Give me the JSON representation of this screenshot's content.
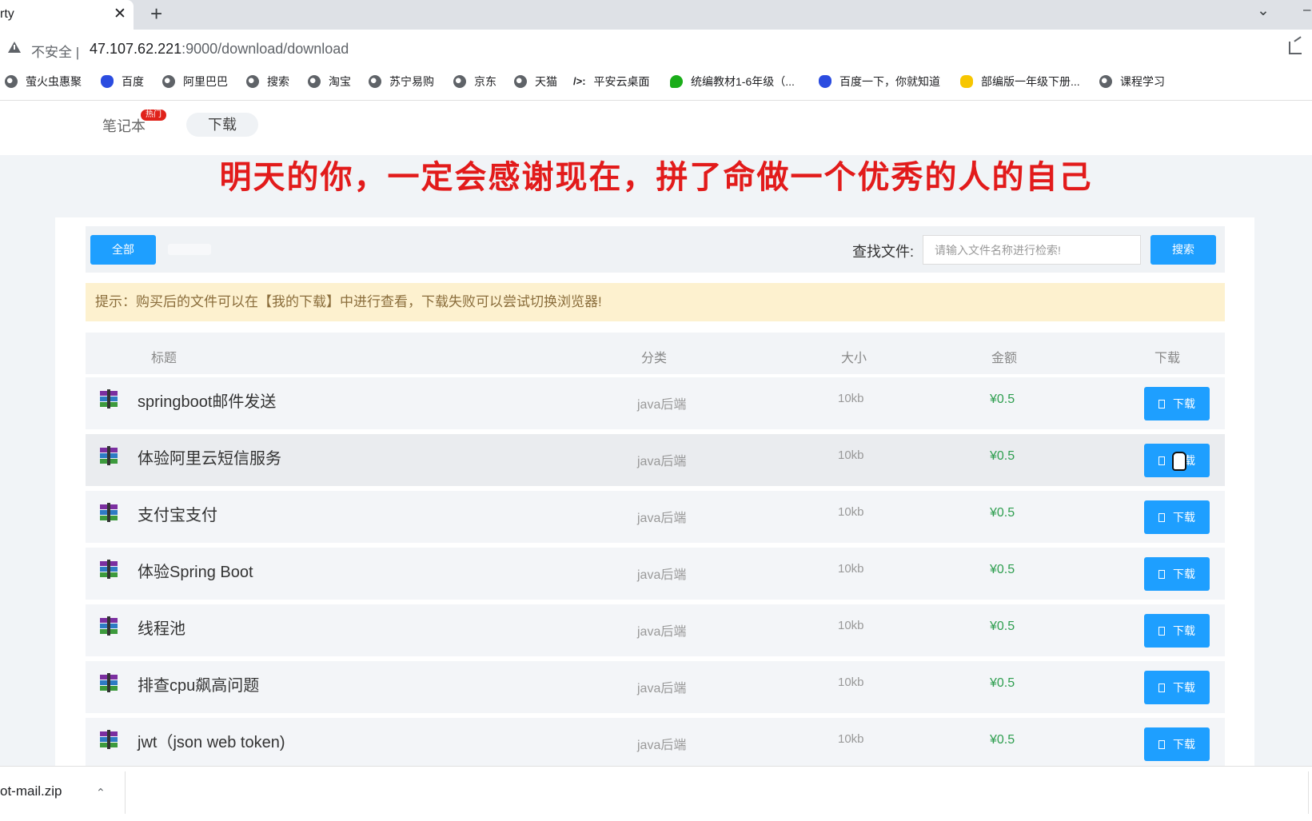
{
  "browser": {
    "tab_title": "rty",
    "tab_close": "✕",
    "new_tab": "+",
    "tab_list": "⌄",
    "minimize": "–",
    "insecure_label": "不安全 |",
    "url_host": "47.107.62.221",
    "url_rest": ":9000/download/download",
    "bookmarks": [
      {
        "label": "萤火虫惠聚",
        "icon": "globe-icon"
      },
      {
        "label": "百度",
        "icon": "baidu-icon"
      },
      {
        "label": "阿里巴巴",
        "icon": "globe-icon"
      },
      {
        "label": "搜索",
        "icon": "globe-icon"
      },
      {
        "label": "淘宝",
        "icon": "globe-icon"
      },
      {
        "label": "苏宁易购",
        "icon": "globe-icon"
      },
      {
        "label": "京东",
        "icon": "globe-icon"
      },
      {
        "label": "天猫",
        "icon": "globe-icon"
      },
      {
        "label": "平安云桌面",
        "icon": "pingan-icon",
        "glyph": "/>:"
      },
      {
        "label": "统编教材1-6年级（...",
        "icon": "wechat-icon"
      },
      {
        "label": "百度一下，你就知道",
        "icon": "baidu-icon"
      },
      {
        "label": "部编版一年级下册...",
        "icon": "bee-icon"
      },
      {
        "label": "课程学习",
        "icon": "globe-icon"
      }
    ]
  },
  "site": {
    "nav": {
      "notebook": "笔记本",
      "hot_badge": "热门",
      "download": "下载"
    },
    "motto": "明天的你，一定会感谢现在，拼了命做一个优秀的人的自己"
  },
  "filter": {
    "all_label": "全部",
    "find_label": "查找文件:",
    "search_placeholder": "请输入文件名称进行检索!",
    "search_button": "搜索"
  },
  "tip": "提示：购买后的文件可以在【我的下载】中进行查看，下载失败可以尝试切换浏览器!",
  "table": {
    "headers": {
      "title": "标题",
      "category": "分类",
      "size": "大小",
      "price": "金额",
      "download": "下载"
    },
    "download_label": "下载",
    "rows": [
      {
        "title": "springboot邮件发送",
        "category": "java后端",
        "size": "10kb",
        "price": "¥0.5"
      },
      {
        "title": "体验阿里云短信服务",
        "category": "java后端",
        "size": "10kb",
        "price": "¥0.5"
      },
      {
        "title": "支付宝支付",
        "category": "java后端",
        "size": "10kb",
        "price": "¥0.5"
      },
      {
        "title": "体验Spring Boot",
        "category": "java后端",
        "size": "10kb",
        "price": "¥0.5"
      },
      {
        "title": "线程池",
        "category": "java后端",
        "size": "10kb",
        "price": "¥0.5"
      },
      {
        "title": "排查cpu飙高问题",
        "category": "java后端",
        "size": "10kb",
        "price": "¥0.5"
      },
      {
        "title": "jwt（json web token)",
        "category": "java后端",
        "size": "10kb",
        "price": "¥0.5"
      }
    ]
  },
  "download_shelf": {
    "file_name": "ot-mail.zip",
    "chevron": "⌄"
  },
  "colors": {
    "primary": "#1e9fff",
    "motto": "#e21b1b",
    "price": "#2e9e4f",
    "tip_bg": "#fdf1cf",
    "hot": "#e0221a"
  }
}
